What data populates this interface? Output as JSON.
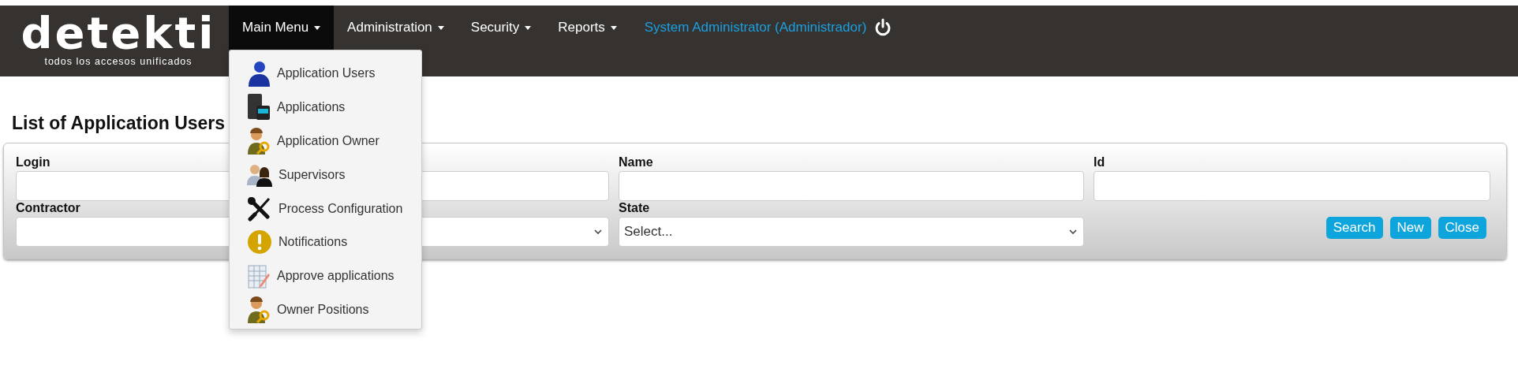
{
  "brand": {
    "name": "detekti",
    "tagline": "todos los accesos unificados"
  },
  "nav": [
    {
      "label": "Main Menu",
      "selected": true,
      "dropdown": true
    },
    {
      "label": "Administration",
      "selected": false,
      "dropdown": true
    },
    {
      "label": "Security",
      "selected": false,
      "dropdown": true
    },
    {
      "label": "Reports",
      "selected": false,
      "dropdown": true
    }
  ],
  "user": {
    "label": "System Administrator (Administrador)"
  },
  "menu": [
    {
      "label": "Application Users"
    },
    {
      "label": "Applications"
    },
    {
      "label": "Application Owner"
    },
    {
      "label": "Supervisors"
    },
    {
      "label": "Process Configuration"
    },
    {
      "label": "Notifications"
    },
    {
      "label": "Approve applications"
    },
    {
      "label": "Owner Positions"
    }
  ],
  "page_title": "List of Application Users",
  "filters": [
    {
      "label": "Login",
      "kind": "text"
    },
    {
      "kind": "text"
    },
    {
      "label": "Name",
      "kind": "text"
    },
    {
      "label": "Id",
      "kind": "text"
    },
    {
      "label": "Contractor",
      "kind": "text"
    },
    {
      "kind": "select"
    },
    {
      "label": "State",
      "kind": "select",
      "value": "Select..."
    }
  ],
  "buttons": [
    "Search",
    "New",
    "Close"
  ]
}
